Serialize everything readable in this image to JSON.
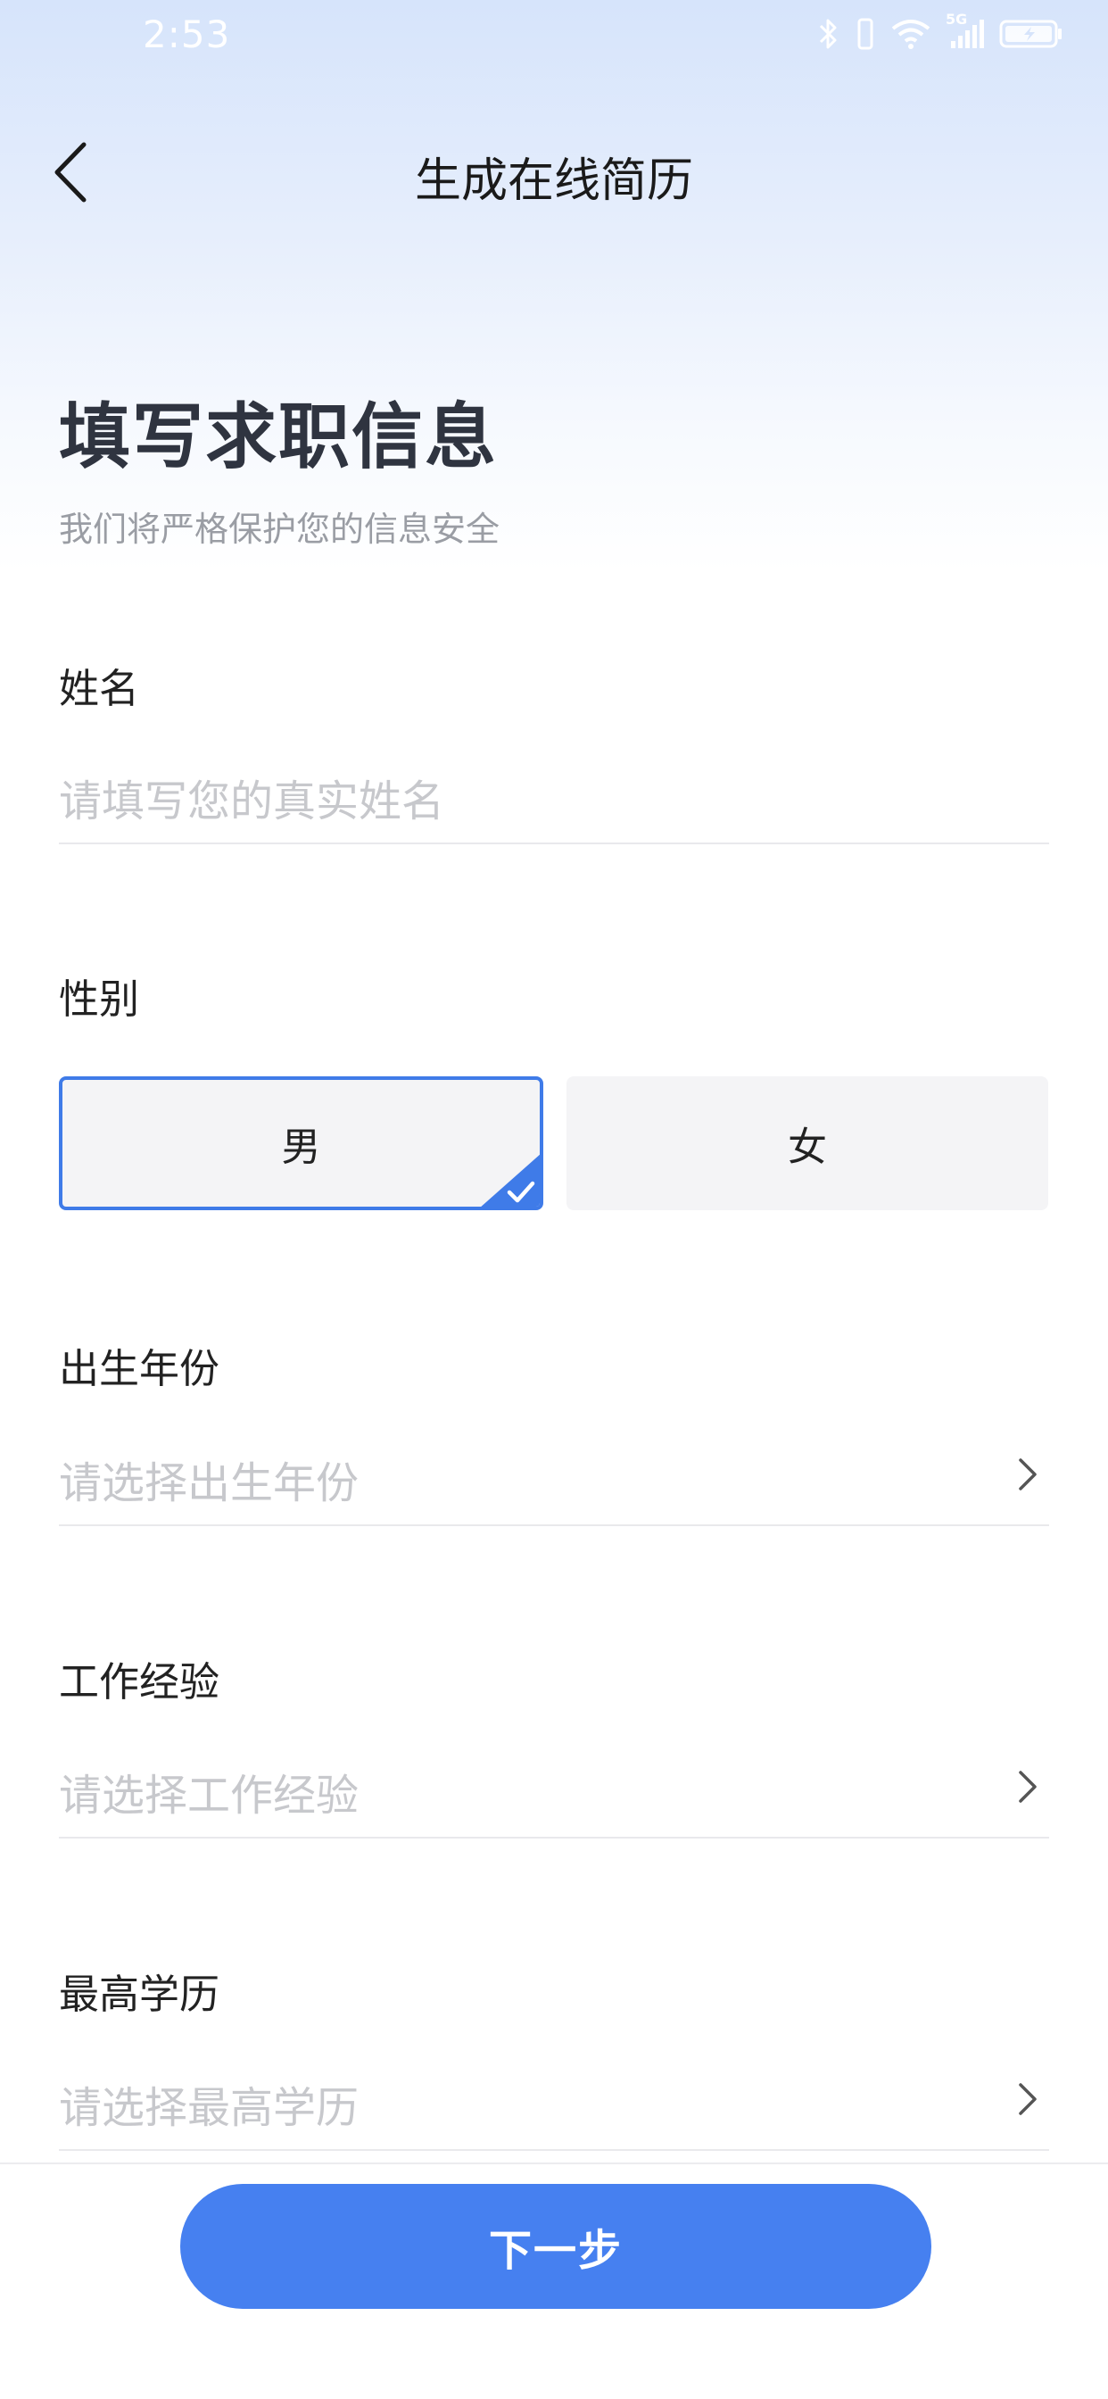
{
  "status_bar": {
    "time": "2:53",
    "network": "5G"
  },
  "nav": {
    "title": "生成在线简历"
  },
  "heading": {
    "title": "填写求职信息",
    "subtitle": "我们将严格保护您的信息安全"
  },
  "form": {
    "name": {
      "label": "姓名",
      "placeholder": "请填写您的真实姓名"
    },
    "gender": {
      "label": "性别",
      "options": [
        "男",
        "女"
      ],
      "selected": "男"
    },
    "birth_year": {
      "label": "出生年份",
      "placeholder": "请选择出生年份"
    },
    "work_experience": {
      "label": "工作经验",
      "placeholder": "请选择工作经验"
    },
    "education": {
      "label": "最高学历",
      "placeholder": "请选择最高学历"
    }
  },
  "footer": {
    "next_label": "下一步"
  },
  "colors": {
    "accent": "#4680f0",
    "selected_border": "#3f7be8",
    "placeholder": "#c7c8cc"
  },
  "icons": {
    "back": "chevron-left-icon",
    "field_arrow": "chevron-right-icon",
    "selected_check": "check-icon"
  }
}
